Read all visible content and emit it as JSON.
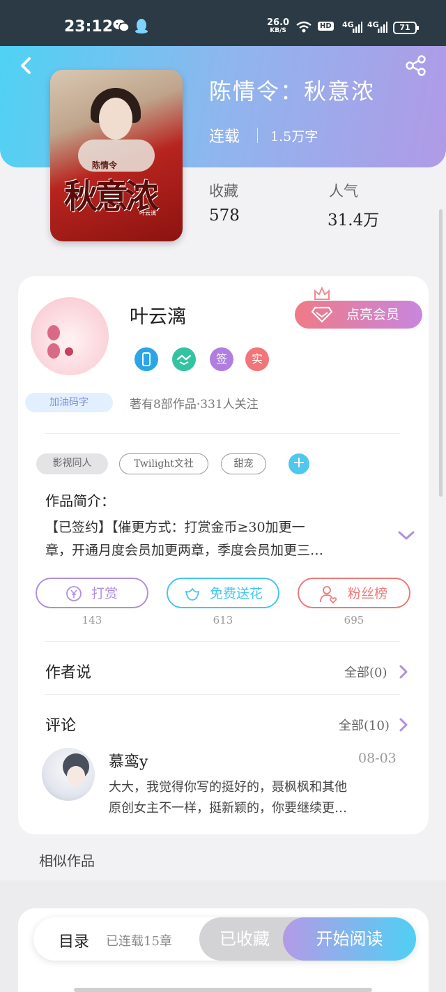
{
  "status_bar": {
    "time": "23:12",
    "speed_value": "26.0",
    "speed_unit": "KB/S",
    "hd": "HD",
    "net1": "4G",
    "net2": "4G",
    "battery": "71",
    "icons": [
      "wechat-icon",
      "qq-icon",
      "wifi-icon",
      "signal-icon",
      "battery-icon"
    ]
  },
  "header": {
    "back_icon": "chevron-left-icon",
    "share_icon": "share-icon"
  },
  "book": {
    "title": "陈情令：秋意浓",
    "status": "连载",
    "word_count": "1.5万字",
    "cover": {
      "series": "陈情令",
      "title": "秋意浓",
      "author": "叶云漓"
    },
    "stats": [
      {
        "label": "收藏",
        "value": "578"
      },
      {
        "label": "人气",
        "value": "31.4万"
      }
    ]
  },
  "author": {
    "name": "叶云漓",
    "badge_label": "加油码字",
    "vip_button": "点亮会员",
    "meta": "著有8部作品·331人关注",
    "badges": [
      {
        "icon": "phone-badge-icon",
        "text": "",
        "color": "#2aa6e8"
      },
      {
        "icon": "handshake-badge-icon",
        "text": "",
        "color": "#33c3a3"
      },
      {
        "icon": "signed-badge-icon",
        "text": "签",
        "color": "#b07ee0"
      },
      {
        "icon": "verified-badge-icon",
        "text": "实",
        "color": "#f07679"
      }
    ]
  },
  "tags": [
    {
      "label": "影视同人",
      "style": "filled"
    },
    {
      "label": "Twilight文社",
      "style": "outline"
    },
    {
      "label": "甜宠",
      "style": "outline"
    }
  ],
  "intro": {
    "title": "作品简介：",
    "lines": [
      "【已签约】【催更方式：打赏金币≥30加更一",
      "章，开通月度会员加更两章，季度会员加更三…"
    ]
  },
  "actions": [
    {
      "label": "打赏",
      "count": "143",
      "icon": "yen-icon",
      "color": "#b08ee0"
    },
    {
      "label": "免费送花",
      "count": "613",
      "icon": "flower-icon",
      "color": "#44c6ef"
    },
    {
      "label": "粉丝榜",
      "count": "695",
      "icon": "user-heart-icon",
      "color": "#f07878"
    }
  ],
  "author_says": {
    "title": "作者说",
    "link": "全部(0)"
  },
  "comments": {
    "title": "评论",
    "link": "全部(10)",
    "items": [
      {
        "name": "慕鸾y",
        "date": "08-03",
        "lines": [
          "大大，我觉得你写的挺好的，聂枫枫和其他",
          "原创女主不一样，挺新颖的，你要继续更…"
        ]
      }
    ]
  },
  "similar": {
    "title": "相似作品"
  },
  "bottom_bar": {
    "toc": "目录",
    "toc_sub": "已连载15章",
    "collected": "已收藏",
    "read": "开始阅读"
  }
}
